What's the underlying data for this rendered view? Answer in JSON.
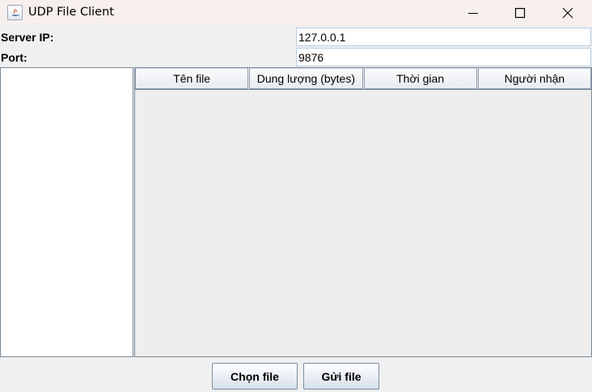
{
  "window": {
    "title": "UDP File Client",
    "icon": "java-app-icon"
  },
  "form": {
    "server_ip_label": "Server IP:",
    "server_ip_value": "127.0.0.1",
    "port_label": "Port:",
    "port_value": "9876"
  },
  "table": {
    "columns": [
      "Tên file",
      "Dung lượng (bytes)",
      "Thời gian",
      "Người nhận"
    ],
    "rows": []
  },
  "actions": {
    "choose_label": "Chọn file",
    "send_label": "Gửi file"
  },
  "colors": {
    "titlebar_bg": "#f6efed",
    "window_bg": "#f0f0f0",
    "border": "#7a8a99"
  }
}
